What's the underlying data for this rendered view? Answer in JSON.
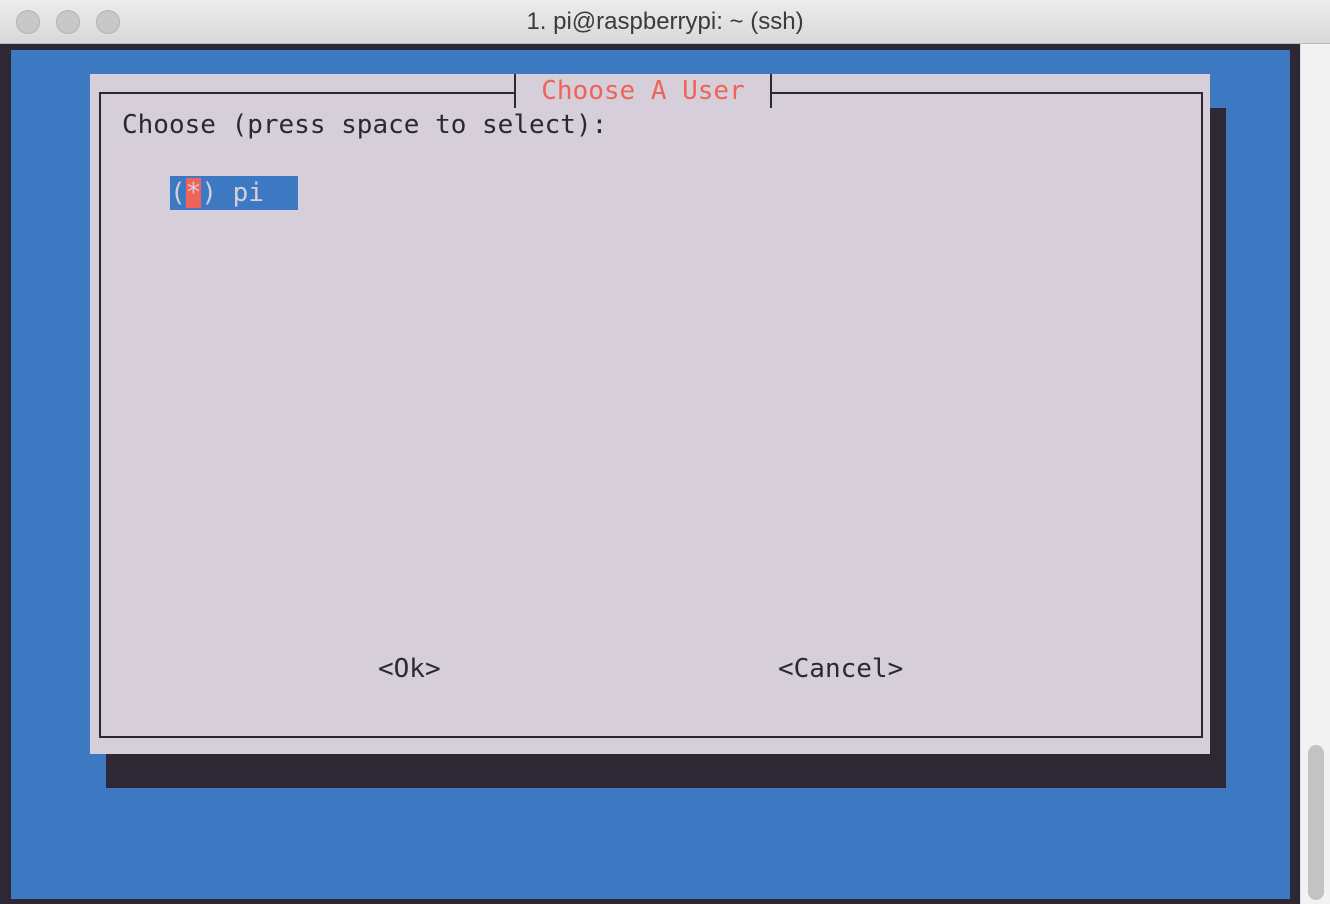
{
  "window": {
    "title": "1. pi@raspberrypi: ~ (ssh)"
  },
  "dialog": {
    "title": "Choose A User",
    "prompt": "Choose (press space to select):",
    "items": [
      {
        "open": "(",
        "mark": "*",
        "close_label": ") pi ",
        "selected": true
      }
    ],
    "buttons": {
      "ok": "<Ok>",
      "cancel": "<Cancel>"
    }
  },
  "colors": {
    "terminal_bg": "#3d78c3",
    "dialog_bg": "#d6ced9",
    "title_color": "#f0635a",
    "shadow": "#2e2734"
  }
}
